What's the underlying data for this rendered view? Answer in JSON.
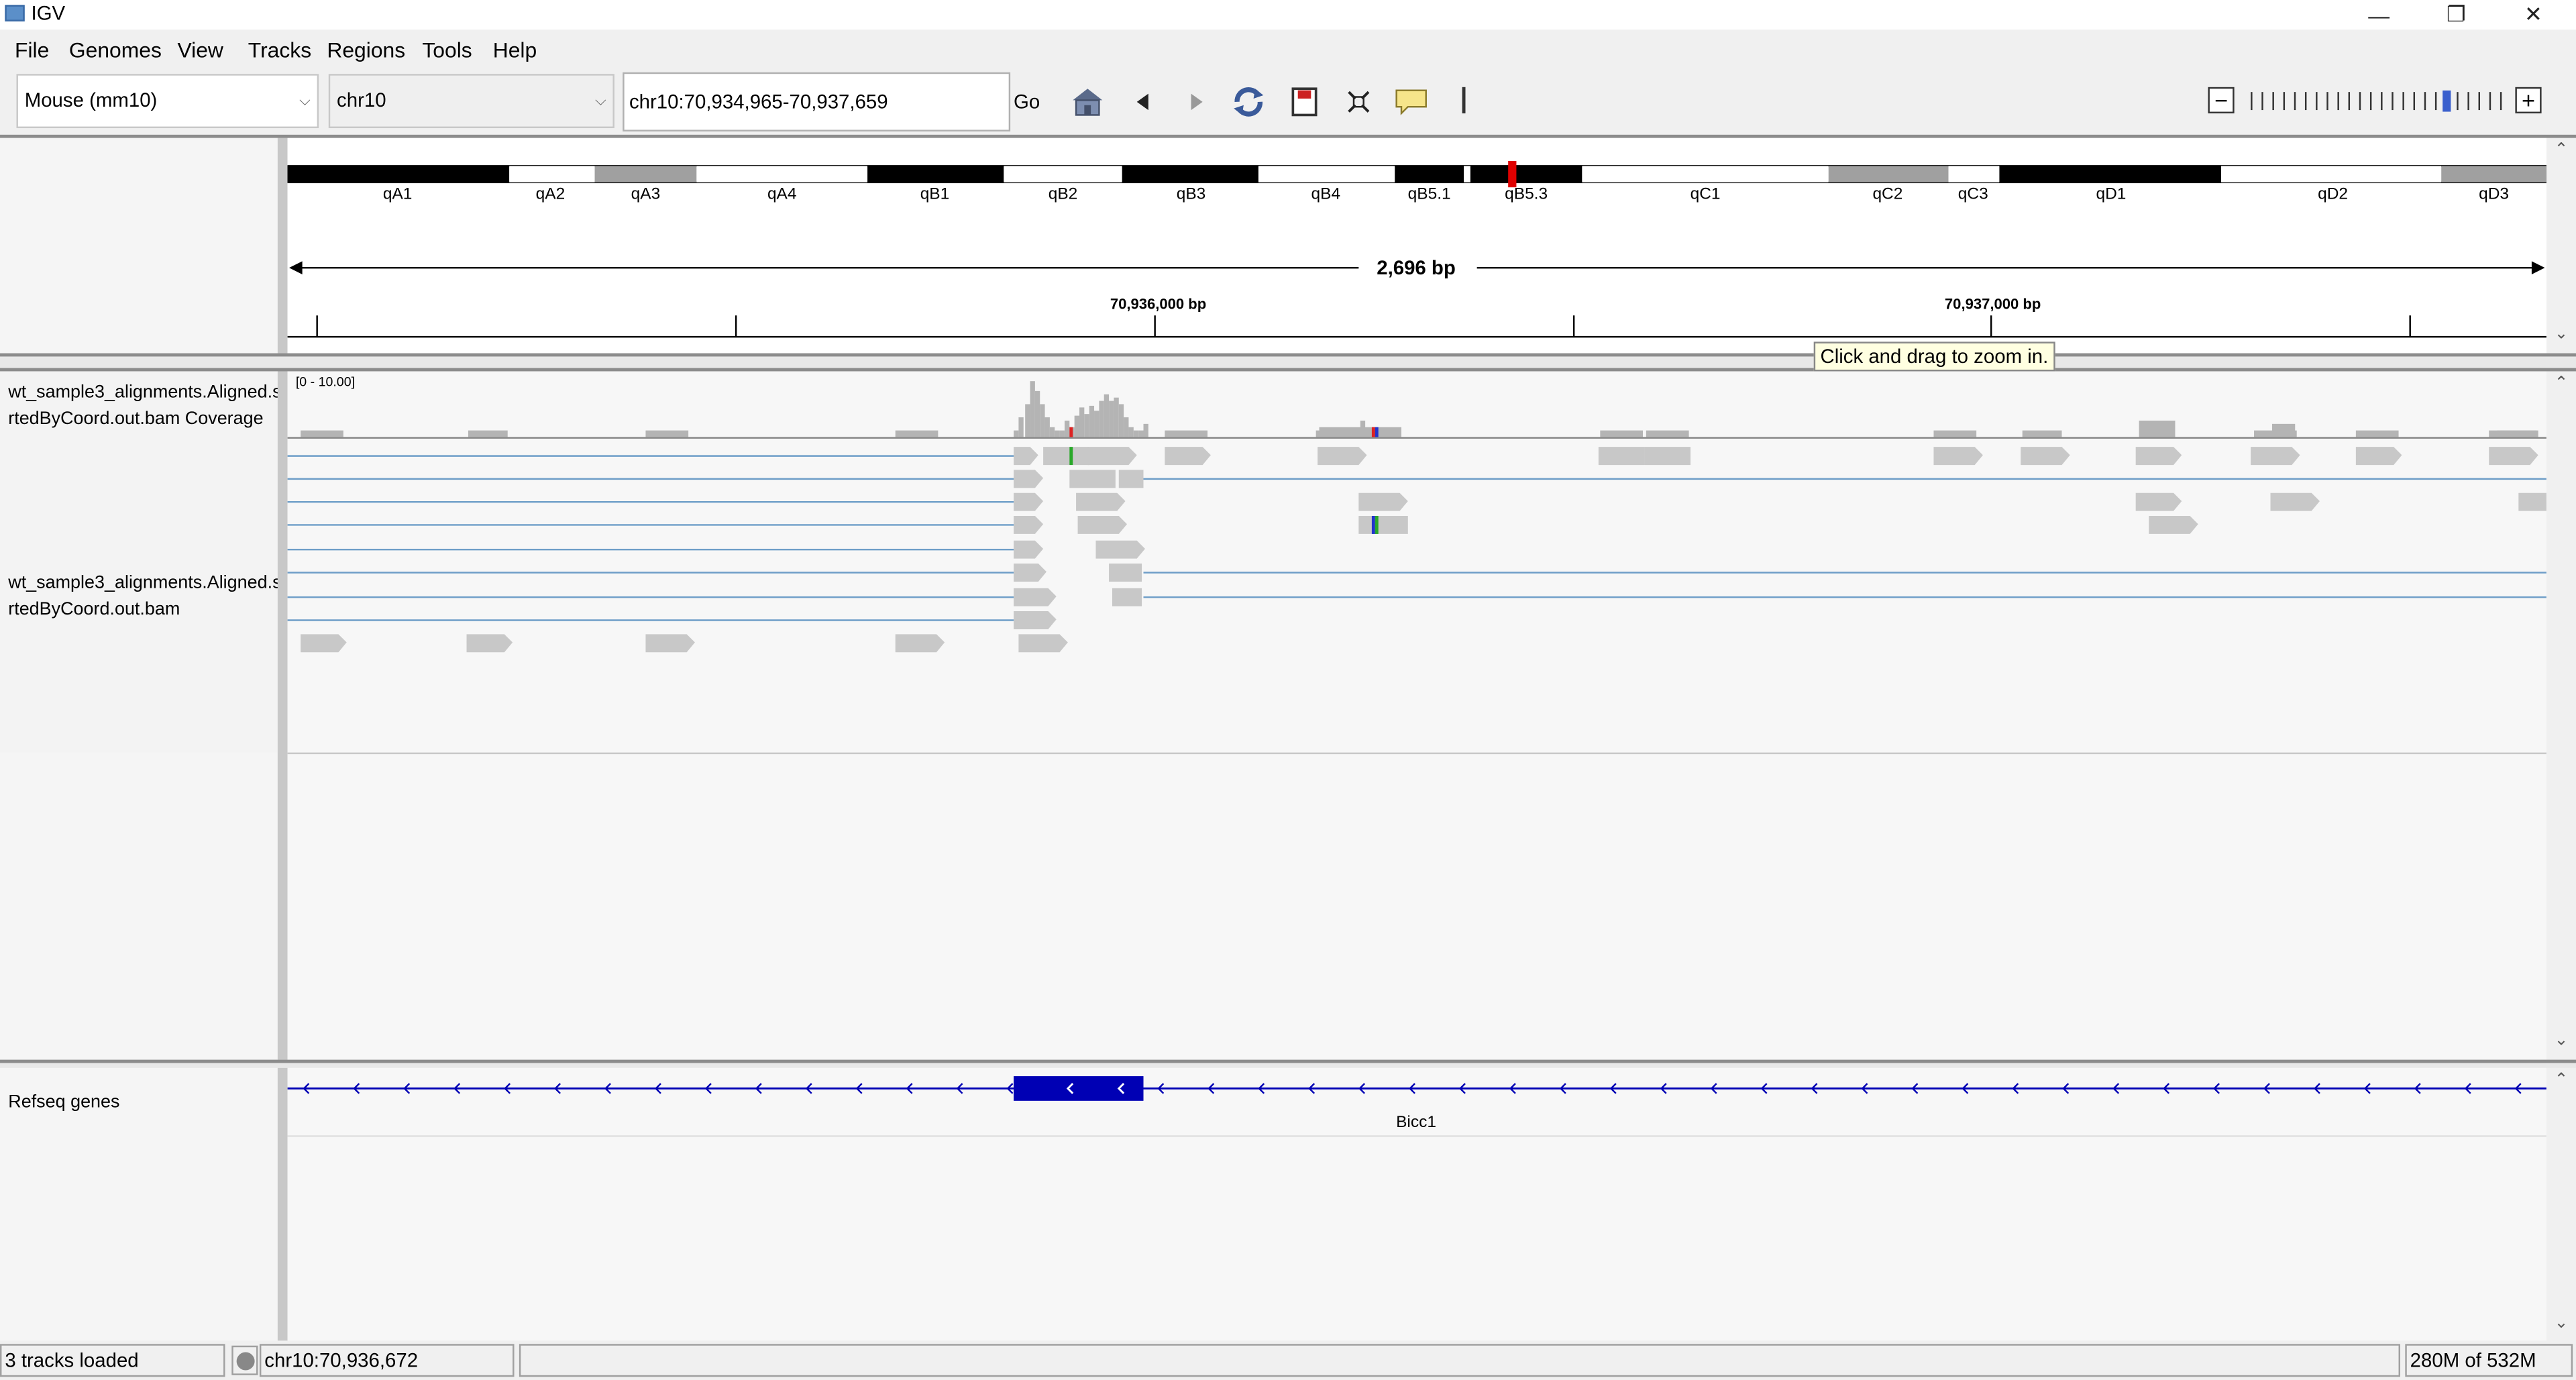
{
  "window": {
    "title": "IGV",
    "minimize_icon": "minimize-icon",
    "restore_icon": "restore-icon",
    "close_icon": "close-icon"
  },
  "menu": [
    {
      "label": "File"
    },
    {
      "label": "Genomes"
    },
    {
      "label": "View"
    },
    {
      "label": "Tracks"
    },
    {
      "label": "Regions"
    },
    {
      "label": "Tools"
    },
    {
      "label": "Help"
    }
  ],
  "toolbar": {
    "genome_select": "Mouse (mm10)",
    "chromosome_select": "chr10",
    "locus": "chr10:70,934,965-70,937,659",
    "go_label": "Go",
    "icons": [
      "home-icon",
      "back-icon",
      "forward-icon",
      "refresh-icon",
      "region-of-interest-icon",
      "fit-to-window-icon",
      "popup-text-icon"
    ]
  },
  "ideogram": {
    "bands": [
      {
        "name": "qA1",
        "stain": "black"
      },
      {
        "name": "qA2",
        "stain": "white"
      },
      {
        "name": "qA3",
        "stain": "gray"
      },
      {
        "name": "qA4",
        "stain": "white"
      },
      {
        "name": "qB1",
        "stain": "black"
      },
      {
        "name": "qB2",
        "stain": "white"
      },
      {
        "name": "qB3",
        "stain": "black"
      },
      {
        "name": "qB4",
        "stain": "white"
      },
      {
        "name": "qB5.1",
        "stain": "black"
      },
      {
        "name": "qB5.3",
        "stain": "black"
      },
      {
        "name": "qC1",
        "stain": "white"
      },
      {
        "name": "qC2",
        "stain": "gray"
      },
      {
        "name": "qC3",
        "stain": "white"
      },
      {
        "name": "qD1",
        "stain": "black"
      },
      {
        "name": "qD2",
        "stain": "white"
      },
      {
        "name": "qD3",
        "stain": "gray"
      }
    ],
    "current_region_color": "#e00000"
  },
  "ruler": {
    "span_label": "2,696 bp",
    "tick_labels": [
      "70,936,000 bp",
      "70,937,000 bp"
    ]
  },
  "tooltip": "Click and drag to zoom in.",
  "tracks": {
    "coverage_name": "wt_sample3_alignments.Aligned.sortedByCoord.out.bam Coverage",
    "coverage_name_line1": "wt_sample3_alignments.Aligned.s",
    "coverage_name_line2": "rtedByCoord.out.bam Coverage",
    "coverage_range": "[0 - 10.00]",
    "alignment_name_line1": "wt_sample3_alignments.Aligned.s",
    "alignment_name_line2": "rtedByCoord.out.bam",
    "genes_name": "Refseq genes",
    "gene_label": "Bicc1"
  },
  "colors": {
    "read_fill": "#c8c8c8",
    "coverage_fill": "#b4b4b4",
    "junction_line": "#6e9ec8",
    "gene_blue": "#0000b4",
    "zoom_indicator": "#3a5fcd",
    "mismatch_green": "#29a829",
    "mismatch_red": "#d22",
    "mismatch_blue": "#2233cc"
  },
  "status": {
    "tracks_loaded": "3 tracks loaded",
    "position": "chr10:70,936,672",
    "message": "",
    "memory": "280M of 532M"
  }
}
